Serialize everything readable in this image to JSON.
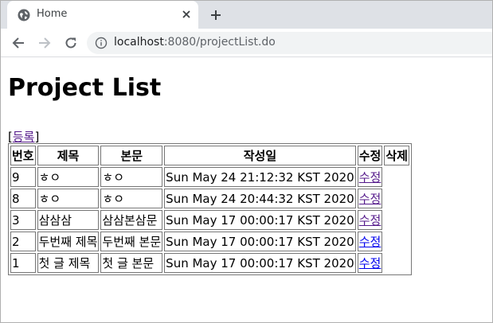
{
  "browser": {
    "tab_title": "Home",
    "url_host": "localhost",
    "url_rest": ":8080/projectList.do"
  },
  "page": {
    "heading": "Project List",
    "register_open": "[",
    "register_link": "등록",
    "register_close": "]"
  },
  "table": {
    "headers": [
      "번호",
      "제목",
      "본문",
      "작성일",
      "수정",
      "삭제"
    ],
    "rows": [
      {
        "no": "9",
        "title": "ㅎㅇ",
        "body": "ㅎㅇ",
        "date": "Sun May 24 21:12:32 KST 2020",
        "edit": "수정"
      },
      {
        "no": "8",
        "title": "ㅎㅇ",
        "body": "ㅎㅇ",
        "date": "Sun May 24 20:44:32 KST 2020",
        "edit": "수정"
      },
      {
        "no": "3",
        "title": "삼삼삼",
        "body": "삼삼본삼문",
        "date": "Sun May 17 00:00:17 KST 2020",
        "edit": "수정"
      },
      {
        "no": "2",
        "title": "두번째 제목",
        "body": "두번째 본문",
        "date": "Sun May 17 00:00:17 KST 2020",
        "edit": "수정"
      },
      {
        "no": "1",
        "title": "첫 글 제목",
        "body": "첫 글 본문",
        "date": "Sun May 17 00:00:17 KST 2020",
        "edit": "수정"
      }
    ]
  },
  "icons": {
    "favicon": "globe-icon",
    "close": "close-icon",
    "new_tab": "plus-icon",
    "back": "back-arrow-icon",
    "forward": "forward-arrow-icon",
    "reload": "reload-icon",
    "info": "info-icon"
  }
}
